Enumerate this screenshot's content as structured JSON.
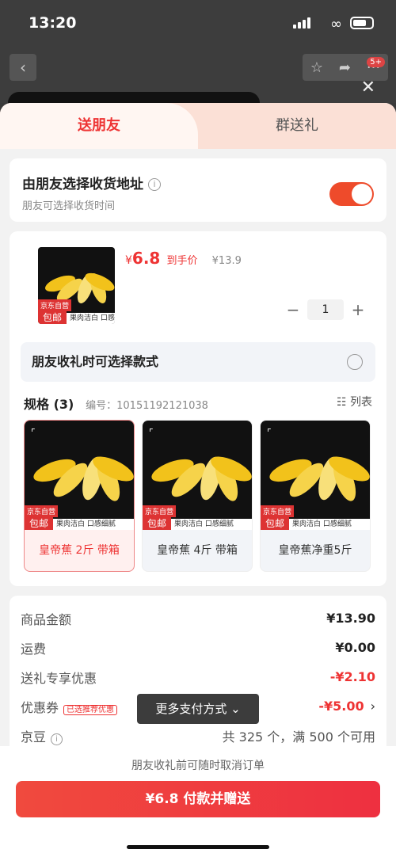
{
  "status": {
    "time": "13:20"
  },
  "nav": {
    "badge": "5+"
  },
  "tabs": [
    {
      "label": "送朋友"
    },
    {
      "label": "群送礼"
    }
  ],
  "address": {
    "title": "由朋友选择收货地址",
    "subtitle": "朋友可选择收货时间",
    "toggle_on": true
  },
  "product": {
    "price_symbol": "¥",
    "price": "6.8",
    "price_label": "到手价",
    "original_price": "¥13.9",
    "quantity": "1",
    "badge_top": "京东自营",
    "badge_bottom": "包邮",
    "strip_text": "果肉洁白 口感细腻"
  },
  "choose_style": {
    "label": "朋友收礼时可选择款式"
  },
  "spec": {
    "title": "规格 (3)",
    "code": "编号：10151192121038",
    "list_label": "列表",
    "options": [
      {
        "label": "皇帝蕉 2斤 带箱",
        "selected": true
      },
      {
        "label": "皇帝蕉 4斤 带箱",
        "selected": false
      },
      {
        "label": "皇帝蕉净重5斤",
        "selected": false
      }
    ]
  },
  "summary": {
    "goods_label": "商品金额",
    "goods_value": "¥13.90",
    "shipping_label": "运费",
    "shipping_value": "¥0.00",
    "gift_label": "送礼专享优惠",
    "gift_value": "-¥2.10",
    "coupon_label": "优惠券",
    "coupon_tag": "已选推荐优惠",
    "coupon_value": "-¥5.00",
    "jd_label": "京豆",
    "jd_value": "共 325 个，满 500 个可用"
  },
  "toast": "更多支付方式 ⌄",
  "footer": {
    "notice": "朋友收礼前可随时取消订单",
    "pay_button": "¥6.8 付款并赠送"
  },
  "colors": {
    "accent": "#ee3040",
    "toggle": "#ee4b2b"
  }
}
